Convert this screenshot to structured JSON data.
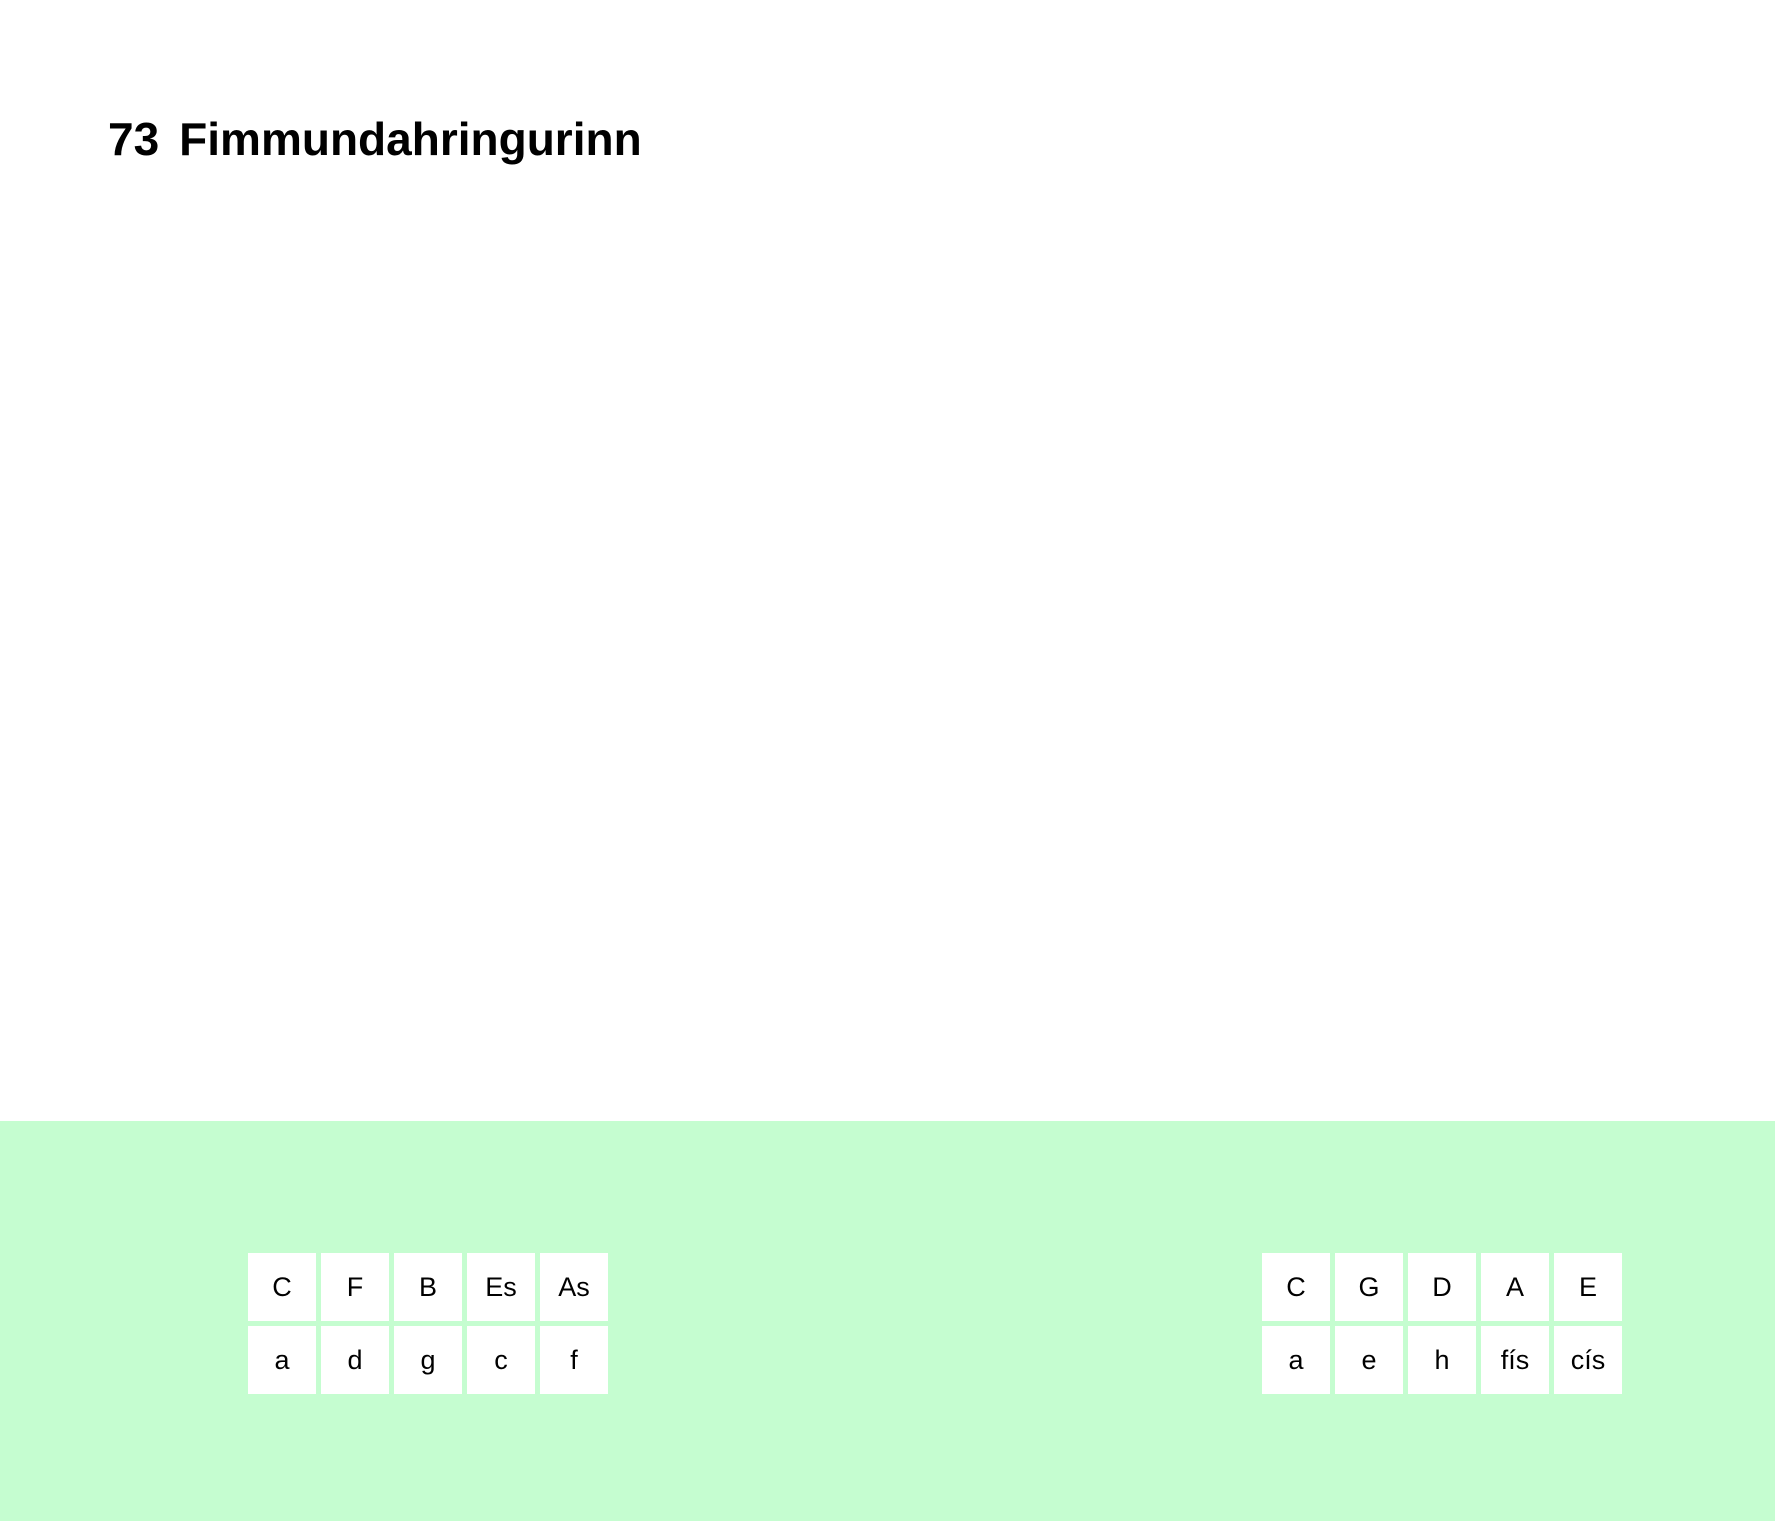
{
  "page": {
    "number": "73",
    "title": "Fimmundahringurinn"
  },
  "colors": {
    "panel_background": "#c5fdd0",
    "cell_background": "#ffffff"
  },
  "flat_keys": {
    "major": [
      "C",
      "F",
      "B",
      "Es",
      "As"
    ],
    "minor": [
      "a",
      "d",
      "g",
      "c",
      "f"
    ]
  },
  "sharp_keys": {
    "major": [
      "C",
      "G",
      "D",
      "A",
      "E"
    ],
    "minor": [
      "a",
      "e",
      "h",
      "fís",
      "cís"
    ]
  }
}
